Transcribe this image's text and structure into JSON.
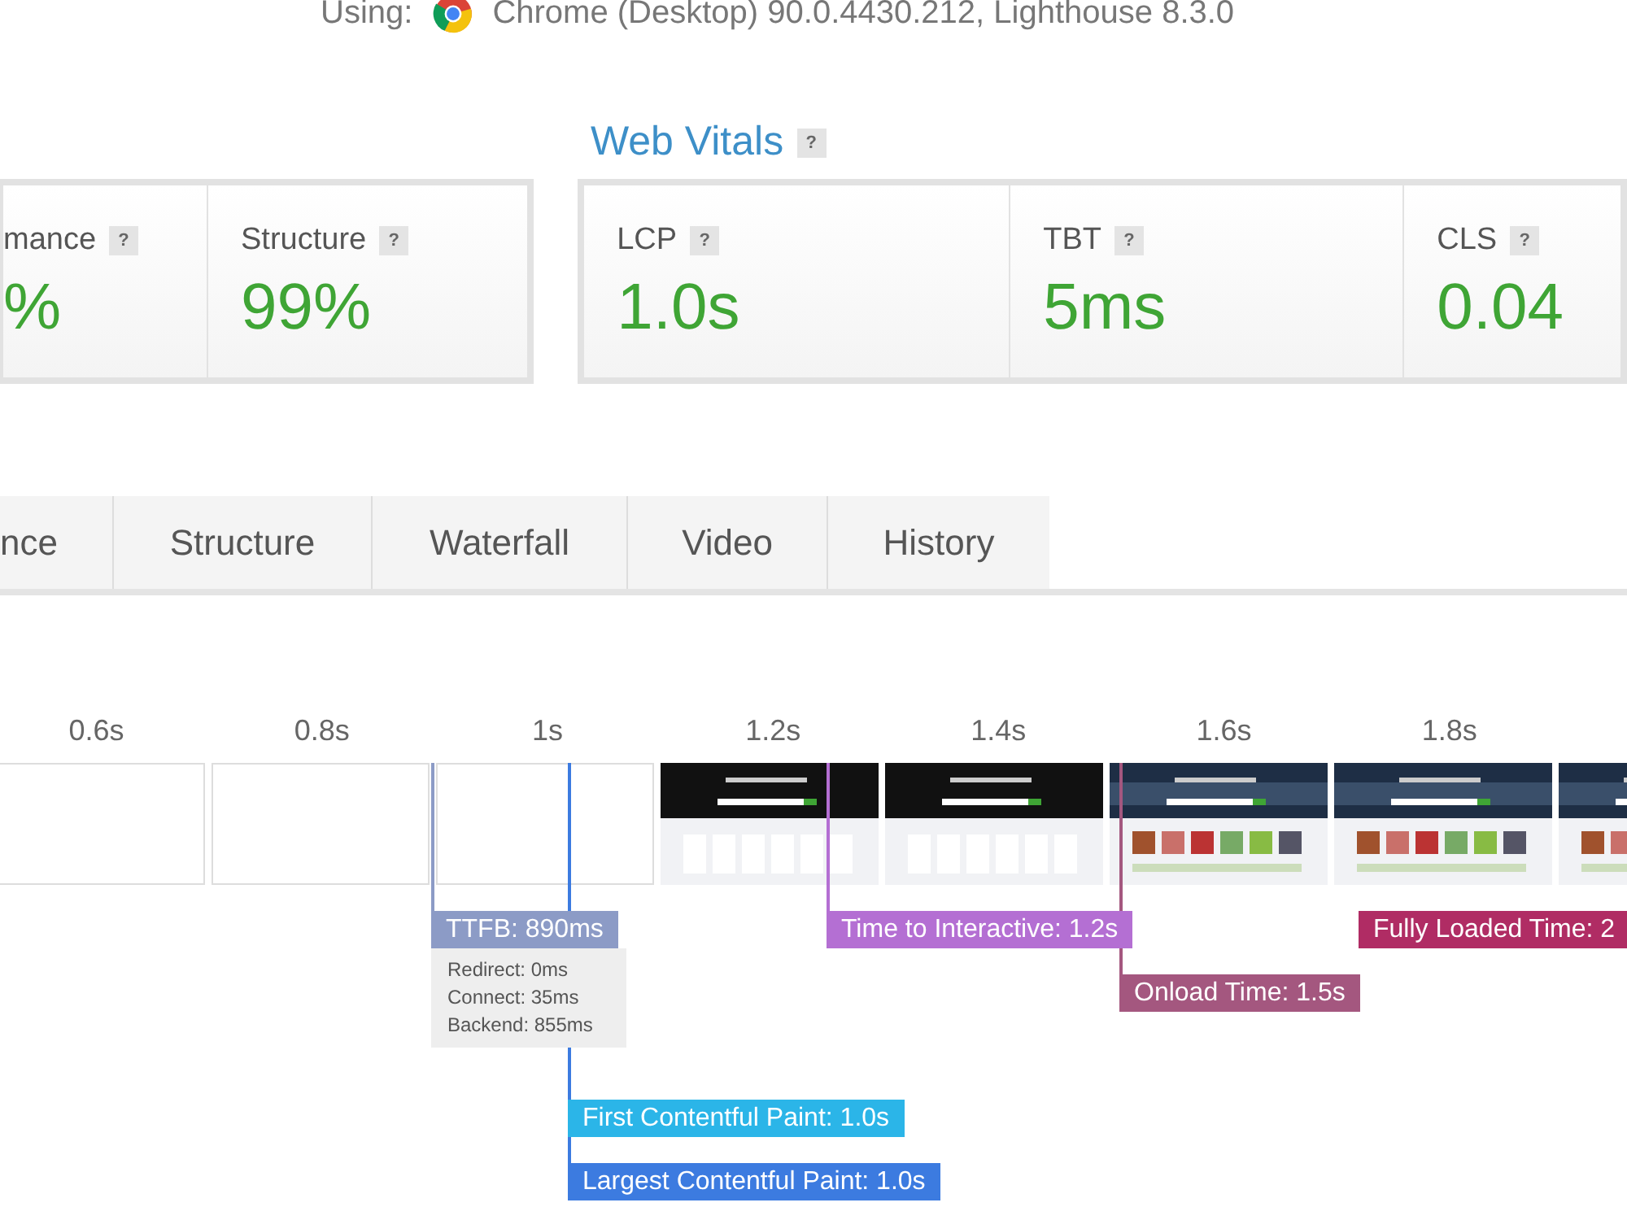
{
  "header": {
    "label": "Using:",
    "browser": "Chrome (Desktop) 90.0.4430.212, Lighthouse 8.3.0"
  },
  "gtmetrix_grade": {
    "metrics": [
      {
        "label": "mance",
        "help": "?",
        "value": "%"
      },
      {
        "label": "Structure",
        "help": "?",
        "value": "99%"
      }
    ]
  },
  "web_vitals": {
    "title": "Web Vitals",
    "help": "?",
    "metrics": [
      {
        "label": "LCP",
        "help": "?",
        "value": "1.0s"
      },
      {
        "label": "TBT",
        "help": "?",
        "value": "5ms"
      },
      {
        "label": "CLS",
        "help": "?",
        "value": "0.04"
      }
    ]
  },
  "tabs": [
    {
      "label": "nce",
      "selected": false
    },
    {
      "label": "Structure",
      "selected": false
    },
    {
      "label": "Waterfall",
      "selected": false
    },
    {
      "label": "Video",
      "selected": false
    },
    {
      "label": "History",
      "selected": false
    }
  ],
  "timeline": {
    "ticks": [
      "0.6s",
      "0.8s",
      "1s",
      "1.2s",
      "1.4s",
      "1.6s",
      "1.8s"
    ],
    "frames": [
      {
        "kind": "blank"
      },
      {
        "kind": "blank"
      },
      {
        "kind": "blank"
      },
      {
        "kind": "picture"
      },
      {
        "kind": "picture"
      },
      {
        "kind": "picture"
      },
      {
        "kind": "picture"
      },
      {
        "kind": "picture"
      }
    ],
    "markers": [
      {
        "label": "TTFB: 890ms",
        "color": "#8c9bc6",
        "details": [
          "Redirect: 0ms",
          "Connect: 35ms",
          "Backend: 855ms"
        ]
      },
      {
        "label": "Time to Interactive: 1.2s",
        "color": "#b46fd3"
      },
      {
        "label": "Fully Loaded Time: 2",
        "color": "#b02c64"
      },
      {
        "label": "Onload Time: 1.5s",
        "color": "#a4577f"
      },
      {
        "label": "First Contentful Paint: 1.0s",
        "color": "#2bb5e8"
      },
      {
        "label": "Largest Contentful Paint: 1.0s",
        "color": "#3c7be0"
      }
    ]
  }
}
